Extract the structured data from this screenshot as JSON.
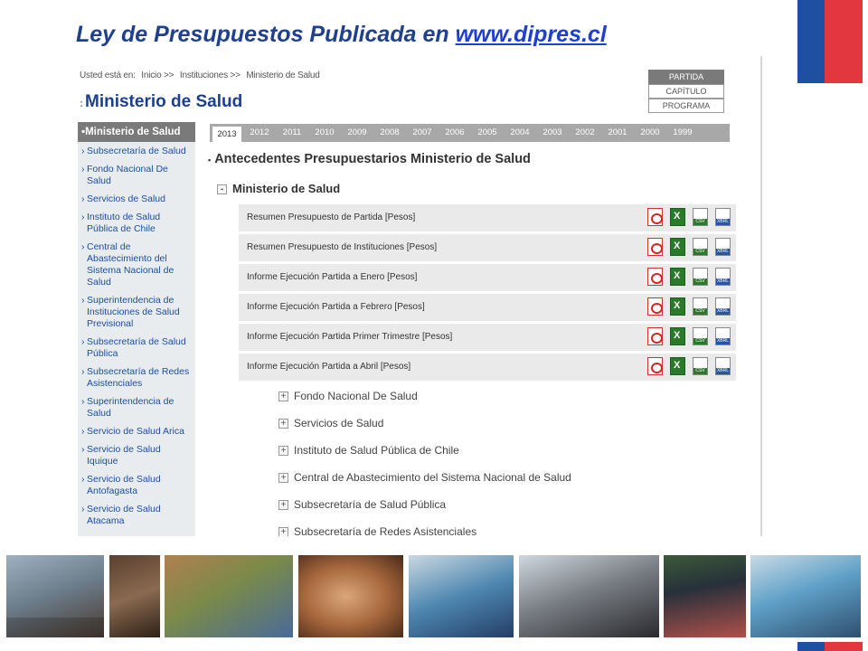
{
  "slide": {
    "title_prefix": "Ley de Presupuestos Publicada en ",
    "title_link": "www.dipres.cl"
  },
  "breadcrumb": [
    "Usted está en:",
    "Inicio >>",
    "Instituciones >>",
    "Ministerio de Salud"
  ],
  "page_title": "Ministerio de Salud",
  "classification": [
    "PARTIDA",
    "CAPÍTULO",
    "PROGRAMA"
  ],
  "sidebar": {
    "head": "Ministerio de Salud",
    "items": [
      "Subsecretaría de Salud",
      "Fondo Nacional De Salud",
      "Servicios de Salud",
      "Instituto de Salud Pública de Chile",
      "Central de Abastecimiento del Sistema Nacional de Salud",
      "Superintendencia de Instituciones de Salud Previsional",
      "Subsecretaría de Salud Pública",
      "Subsecretaría de Redes Asistenciales",
      "Superintendencia de Salud",
      "Servicio de Salud Arica",
      "Servicio de Salud Iquique",
      "Servicio de Salud Antofagasta",
      "Servicio de Salud Atacama"
    ]
  },
  "years": [
    "2013",
    "2012",
    "2011",
    "2010",
    "2009",
    "2008",
    "2007",
    "2006",
    "2005",
    "2004",
    "2003",
    "2002",
    "2001",
    "2000",
    "1999"
  ],
  "section_title": "Antecedentes Presupuestarios Ministerio de Salud",
  "expanded": {
    "toggle": "-",
    "title": "Ministerio de Salud",
    "rows": [
      "Resumen Presupuesto de Partida [Pesos]",
      "Resumen Presupuesto de Instituciones [Pesos]",
      "Informe Ejecución Partida a Enero [Pesos]",
      "Informe Ejecución Partida a Febrero [Pesos]",
      "Informe Ejecución Partida Primer Trimestre [Pesos]",
      "Informe Ejecución Partida a Abril [Pesos]"
    ]
  },
  "collapsed": {
    "toggle": "+",
    "items": [
      "Fondo Nacional De Salud",
      "Servicios de Salud",
      "Instituto de Salud Pública de Chile",
      "Central de Abastecimiento del Sistema Nacional de Salud",
      "Subsecretaría de Salud Pública",
      "Subsecretaría de Redes Asistenciales"
    ]
  },
  "icons": [
    "pdf-icon",
    "excel-icon",
    "csv-icon",
    "xbrl-icon"
  ],
  "colors": {
    "title_blue": "#1f3f8f",
    "link_blue": "#1b4fa0",
    "flag_blue": "#1f4fa0",
    "flag_red": "#e2373f",
    "tab_grey": "#a8a8a8"
  }
}
